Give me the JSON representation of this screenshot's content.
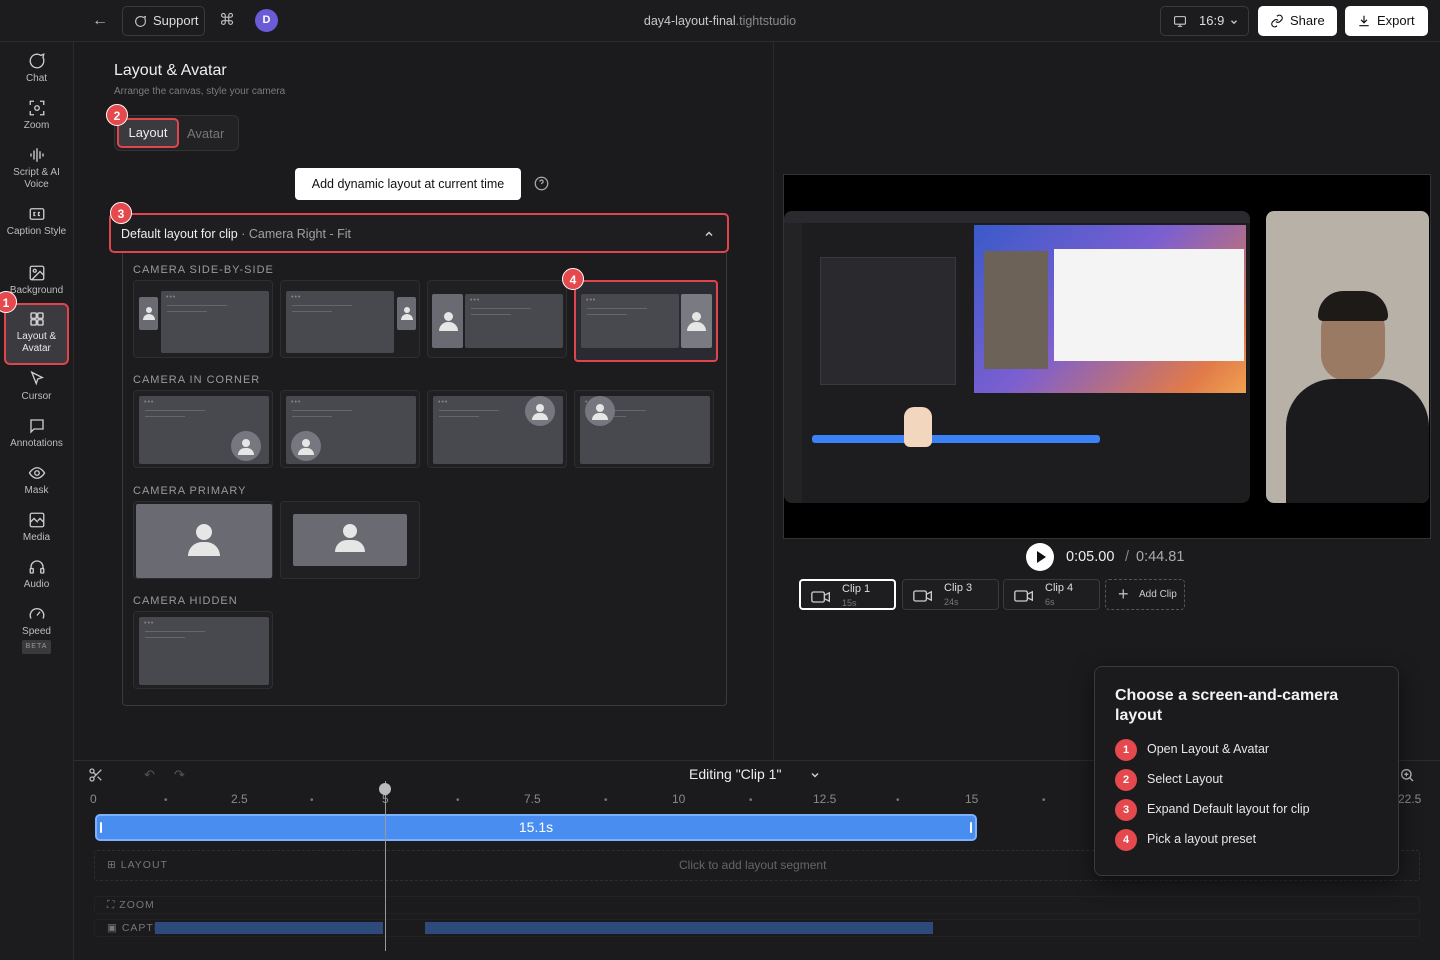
{
  "topbar": {
    "support_label": "Support",
    "avatar_initial": "D",
    "title_name": "day4-layout-final",
    "title_ext": ".tightstudio",
    "aspect_label": "16:9",
    "share_label": "Share",
    "export_label": "Export"
  },
  "sidebar": {
    "items": [
      {
        "label": "Chat",
        "icon": "chat-icon"
      },
      {
        "label": "Zoom",
        "icon": "zoom-icon"
      },
      {
        "label": "Script & AI Voice",
        "icon": "waveform-icon"
      },
      {
        "label": "Caption Style",
        "icon": "cc-icon"
      },
      {
        "label": "Background",
        "icon": "image-icon"
      },
      {
        "label": "Layout & Avatar",
        "icon": "grid-icon"
      },
      {
        "label": "Cursor",
        "icon": "cursor-icon"
      },
      {
        "label": "Annotations",
        "icon": "annotation-icon"
      },
      {
        "label": "Mask",
        "icon": "eye-icon"
      },
      {
        "label": "Media",
        "icon": "media-icon"
      },
      {
        "label": "Audio",
        "icon": "headphones-icon"
      },
      {
        "label": "Speed",
        "icon": "speed-icon",
        "badge": "BETA"
      }
    ]
  },
  "panel": {
    "title": "Layout & Avatar",
    "subtitle": "Arrange the canvas, style your camera",
    "tabs": [
      "Layout",
      "Avatar"
    ],
    "dynamic_button": "Add dynamic layout at current time",
    "dropdown_label": "Default layout for clip",
    "dropdown_value": "· Camera Right - Fit",
    "sections": {
      "side_by_side": "CAMERA SIDE-BY-SIDE",
      "corner": "CAMERA IN CORNER",
      "primary": "CAMERA PRIMARY",
      "hidden": "CAMERA HIDDEN"
    }
  },
  "player": {
    "current_time": "0:05.00",
    "separator": "/",
    "total_time": "0:44.81",
    "clips": [
      {
        "name": "Clip 1",
        "duration": "15s"
      },
      {
        "name": "Clip 3",
        "duration": "24s"
      },
      {
        "name": "Clip 4",
        "duration": "6s"
      }
    ],
    "add_clip_label": "Add Clip"
  },
  "timeline": {
    "editing_label": "Editing \"Clip 1\"",
    "ticks": [
      "0",
      "2.5",
      "5",
      "7.5",
      "10",
      "12.5",
      "15",
      "22.5"
    ],
    "track_label": "15.1s",
    "layout_row": "LAYOUT",
    "layout_hint": "Click to add layout segment",
    "zoom_row": "ZOOM",
    "caption_row": "CAPTION"
  },
  "tooltip": {
    "title": "Choose a screen-and-camera layout",
    "steps": [
      "Open Layout & Avatar",
      "Select Layout",
      "Expand Default layout for clip",
      "Pick a layout preset"
    ]
  },
  "badges": [
    "1",
    "2",
    "3",
    "4"
  ],
  "colors": {
    "accent_red": "#e5484d",
    "track_blue": "#4a8df0",
    "background": "#1b1b1d"
  }
}
